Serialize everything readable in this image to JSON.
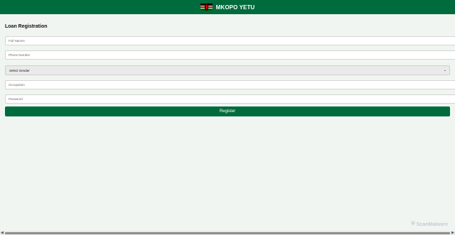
{
  "header": {
    "brand_title": "MKOPO YETU",
    "flag_icon": "kenya-flag-icon",
    "background": "#006b3c"
  },
  "form": {
    "title": "Loan Registration",
    "full_names_placeholder": "Full Names",
    "phone_number_placeholder": "Phone Number",
    "gender_selected": "Select Gender",
    "occupation_placeholder": "Occupation",
    "password_placeholder": "Password",
    "register_label": "Register",
    "accent": "#006b3c"
  },
  "watermark": {
    "text": "ScanMalware",
    "icon": "scanmalware-logo-icon"
  },
  "scrollbar": {
    "left_arrow": "◀",
    "right_arrow": "▶"
  }
}
